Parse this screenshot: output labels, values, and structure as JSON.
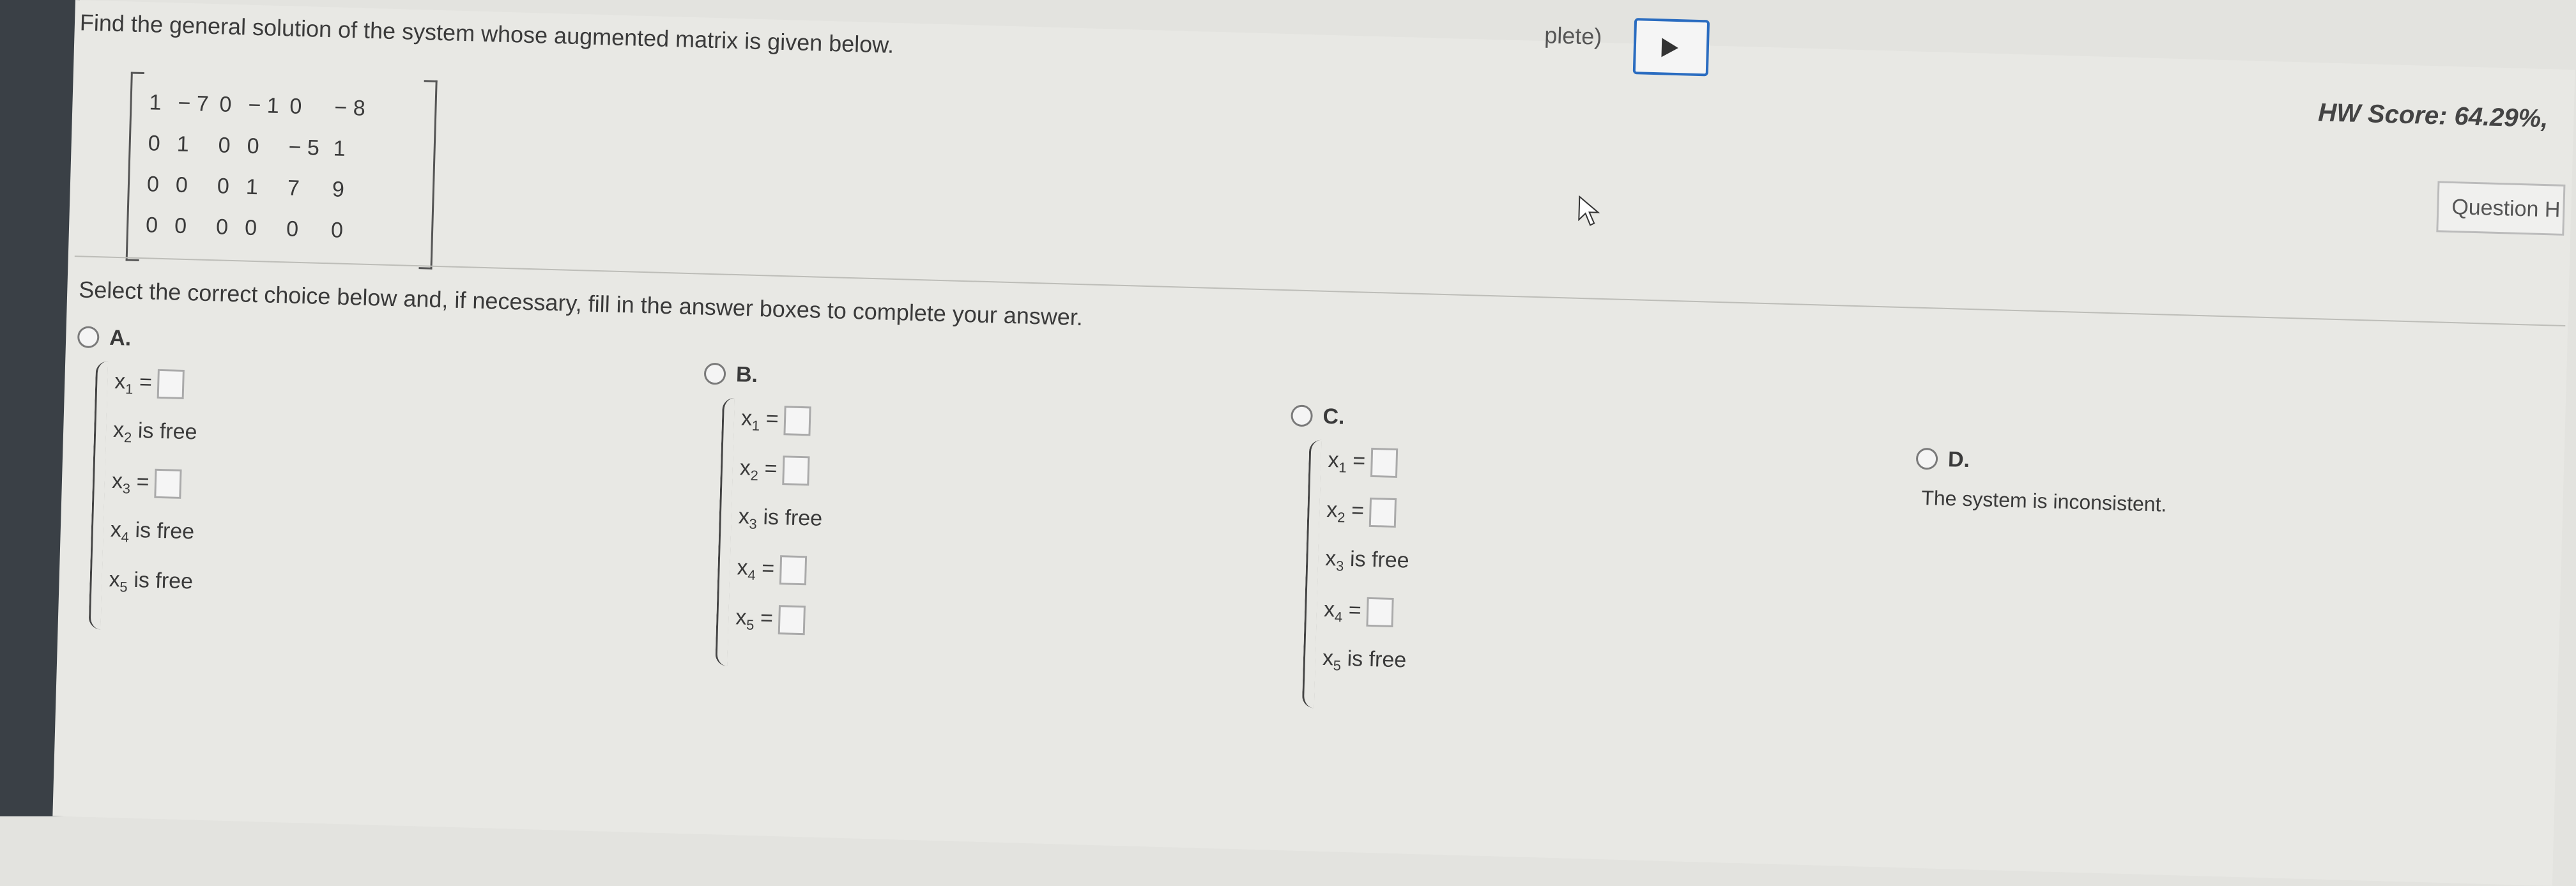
{
  "question": "Find the general solution of the system whose augmented matrix is given below.",
  "matrix": {
    "rows": [
      [
        "1",
        "− 7",
        "0",
        "− 1",
        "0",
        "− 8"
      ],
      [
        "0",
        "1",
        "0",
        "0",
        "− 5",
        "1"
      ],
      [
        "0",
        "0",
        "0",
        "1",
        "7",
        "9"
      ],
      [
        "0",
        "0",
        "0",
        "0",
        "0",
        "0"
      ]
    ]
  },
  "prompt": "Select the correct choice below and, if necessary, fill in the answer boxes to complete your answer.",
  "choices": [
    {
      "letter": "A.",
      "lines": [
        {
          "var": "x",
          "sub": "1",
          "text": " =",
          "box": true
        },
        {
          "var": "x",
          "sub": "2",
          "text": " is free",
          "box": false
        },
        {
          "var": "x",
          "sub": "3",
          "text": " =",
          "box": true
        },
        {
          "var": "x",
          "sub": "4",
          "text": " is free",
          "box": false
        },
        {
          "var": "x",
          "sub": "5",
          "text": " is free",
          "box": false
        }
      ]
    },
    {
      "letter": "B.",
      "lines": [
        {
          "var": "x",
          "sub": "1",
          "text": " =",
          "box": true
        },
        {
          "var": "x",
          "sub": "2",
          "text": " =",
          "box": true
        },
        {
          "var": "x",
          "sub": "3",
          "text": " is free",
          "box": false
        },
        {
          "var": "x",
          "sub": "4",
          "text": " =",
          "box": true
        },
        {
          "var": "x",
          "sub": "5",
          "text": " =",
          "box": true
        }
      ]
    },
    {
      "letter": "C.",
      "lines": [
        {
          "var": "x",
          "sub": "1",
          "text": " =",
          "box": true
        },
        {
          "var": "x",
          "sub": "2",
          "text": " =",
          "box": true
        },
        {
          "var": "x",
          "sub": "3",
          "text": " is free",
          "box": false
        },
        {
          "var": "x",
          "sub": "4",
          "text": " =",
          "box": true
        },
        {
          "var": "x",
          "sub": "5",
          "text": " is free",
          "box": false
        }
      ]
    },
    {
      "letter": "D.",
      "text": "The system is inconsistent."
    }
  ],
  "header": {
    "hw_score": "HW Score: 64.29%,",
    "question_button": "Question H",
    "top_fragment": "plete)"
  }
}
